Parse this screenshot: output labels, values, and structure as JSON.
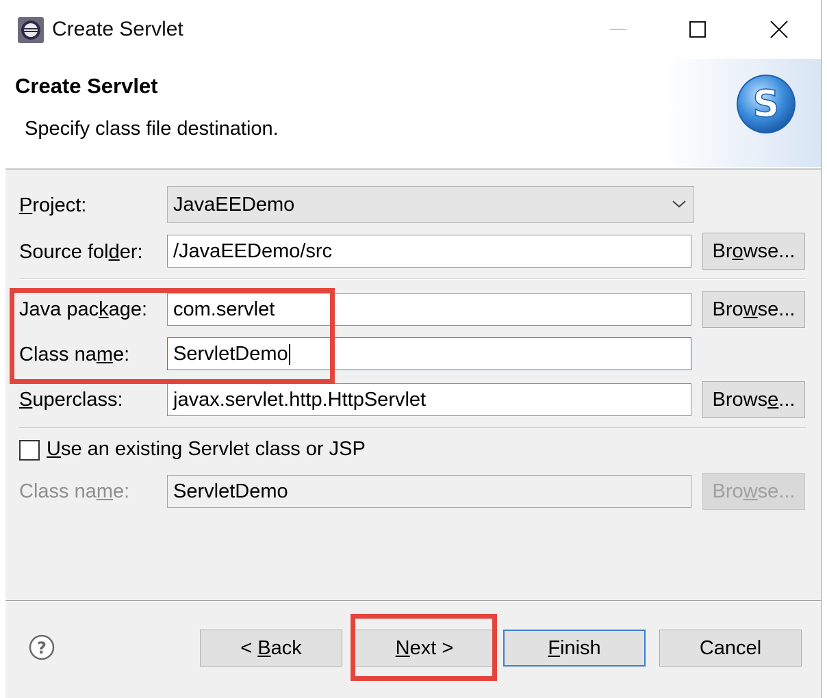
{
  "window": {
    "title": "Create Servlet"
  },
  "banner": {
    "title": "Create Servlet",
    "subtitle": "Specify class file destination."
  },
  "form": {
    "project": {
      "label_pre": "",
      "label_u": "P",
      "label_post": "roject:",
      "value": "JavaEEDemo"
    },
    "source_folder": {
      "label_pre": "Source fol",
      "label_u": "d",
      "label_post": "er:",
      "value": "/JavaEEDemo/src",
      "browse_pre": "Br",
      "browse_u": "o",
      "browse_post": "wse..."
    },
    "java_package": {
      "label_pre": "Java pac",
      "label_u": "k",
      "label_post": "age:",
      "value": "com.servlet",
      "browse_pre": "Bro",
      "browse_u": "w",
      "browse_post": "se..."
    },
    "class_name": {
      "label_pre": "Class na",
      "label_u": "m",
      "label_post": "e:",
      "value": "ServletDemo"
    },
    "superclass": {
      "label_pre": "",
      "label_u": "S",
      "label_post": "uperclass:",
      "value": "javax.servlet.http.HttpServlet",
      "browse_pre": "Brows",
      "browse_u": "e",
      "browse_post": "..."
    },
    "use_existing": {
      "label_pre": "",
      "label_u": "U",
      "label_post": "se an existing Servlet class or JSP",
      "checked": false
    },
    "existing_class": {
      "label_pre": "Class na",
      "label_u": "m",
      "label_post": "e:",
      "value": "ServletDemo",
      "browse_pre": "Bro",
      "browse_u": "w",
      "browse_post": "se..."
    }
  },
  "footer": {
    "back": {
      "pre": "< ",
      "u": "B",
      "post": "ack"
    },
    "next": {
      "pre": "",
      "u": "N",
      "post": "ext >"
    },
    "finish": {
      "pre": "",
      "u": "F",
      "post": "inish"
    },
    "cancel": "Cancel"
  },
  "colors": {
    "highlight": "#e3453c",
    "focus": "#2b7bd6",
    "logo": "#3e8fde"
  }
}
